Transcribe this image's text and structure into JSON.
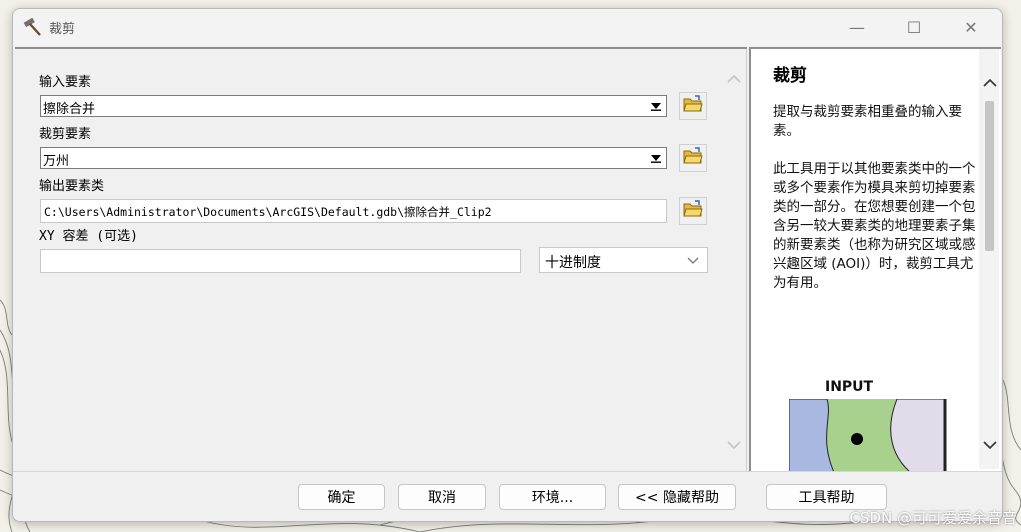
{
  "window": {
    "title": "裁剪",
    "minimize_glyph": "—",
    "maximize_glyph": "☐",
    "close_glyph": "✕"
  },
  "params": {
    "input_features": {
      "label": "输入要素",
      "value": "擦除合并"
    },
    "clip_features": {
      "label": "裁剪要素",
      "value": "万州"
    },
    "output_class": {
      "label": "输出要素类",
      "value": "C:\\Users\\Administrator\\Documents\\ArcGIS\\Default.gdb\\擦除合并_Clip2"
    },
    "xy_tolerance": {
      "label": "XY 容差 (可选)",
      "value": "",
      "unit": "十进制度"
    }
  },
  "help": {
    "title": "裁剪",
    "summary": "提取与裁剪要素相重叠的输入要素。",
    "description": "此工具用于以其他要素类中的一个或多个要素作为模具来剪切掉要素类的一部分。在您想要创建一个包含另一较大要素类的地理要素子集的新要素类（也称为研究区域或感兴趣区域 (AOI)）时，裁剪工具尤为有用。",
    "figure_caption": "INPUT"
  },
  "buttons": {
    "ok": "确定",
    "cancel": "取消",
    "environments": "环境...",
    "hide_help": "<< 隐藏帮助",
    "tool_help": "工具帮助"
  },
  "watermark": "CSDN @可可爱爱余音音",
  "colors": {
    "window_bg": "#f0f0f0",
    "help_bg": "#ffffff",
    "figure_blue": "#a9b8e0",
    "figure_green": "#a9d18e",
    "figure_lilac": "#e2dcea"
  },
  "icons": [
    "hammer-icon",
    "folder-open-icon",
    "chevron-down-icon",
    "chevron-up-icon"
  ]
}
